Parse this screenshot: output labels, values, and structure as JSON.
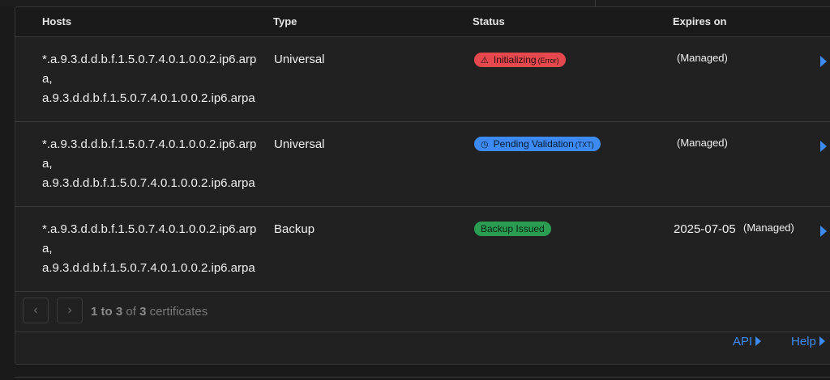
{
  "table": {
    "headers": {
      "hosts": "Hosts",
      "type": "Type",
      "status": "Status",
      "expires": "Expires on"
    },
    "rows": [
      {
        "host_line1": "*.a.9.3.d.d.b.f.1.5.0.7.4.0.1.0.0.2.ip6.arpa,",
        "host_line2": "a.9.3.d.d.b.f.1.5.0.7.4.0.1.0.0.2.ip6.arpa",
        "type": "Universal",
        "status_icon": "warning-triangle-icon",
        "status_text": "Initializing",
        "status_sub": "(Error)",
        "status_color": "#e5484d",
        "expires": "",
        "managed": "(Managed)"
      },
      {
        "host_line1": "*.a.9.3.d.d.b.f.1.5.0.7.4.0.1.0.0.2.ip6.arpa,",
        "host_line2": "a.9.3.d.d.b.f.1.5.0.7.4.0.1.0.0.2.ip6.arpa",
        "type": "Universal",
        "status_icon": "clock-icon",
        "status_text": "Pending Validation",
        "status_sub": "(TXT)",
        "status_color": "#3d8bf2",
        "expires": "",
        "managed": "(Managed)"
      },
      {
        "host_line1": "*.a.9.3.d.d.b.f.1.5.0.7.4.0.1.0.0.2.ip6.arpa,",
        "host_line2": "a.9.3.d.d.b.f.1.5.0.7.4.0.1.0.0.2.ip6.arpa",
        "type": "Backup",
        "status_icon": "",
        "status_text": "Backup Issued",
        "status_sub": "",
        "status_color": "#2a9d52",
        "expires": "2025-07-05",
        "managed": "(Managed)"
      }
    ]
  },
  "pagination": {
    "prev_icon": "chevron-left-icon",
    "next_icon": "chevron-right-icon",
    "start": "1",
    "to_word": "to",
    "end": "3",
    "of_word": "of",
    "total": "3",
    "unit": "certificates"
  },
  "footer": {
    "api_label": "API",
    "help_label": "Help"
  },
  "colors": {
    "accent": "#3d8bf2",
    "error": "#e5484d",
    "success": "#2a9d52",
    "background": "#212121"
  }
}
